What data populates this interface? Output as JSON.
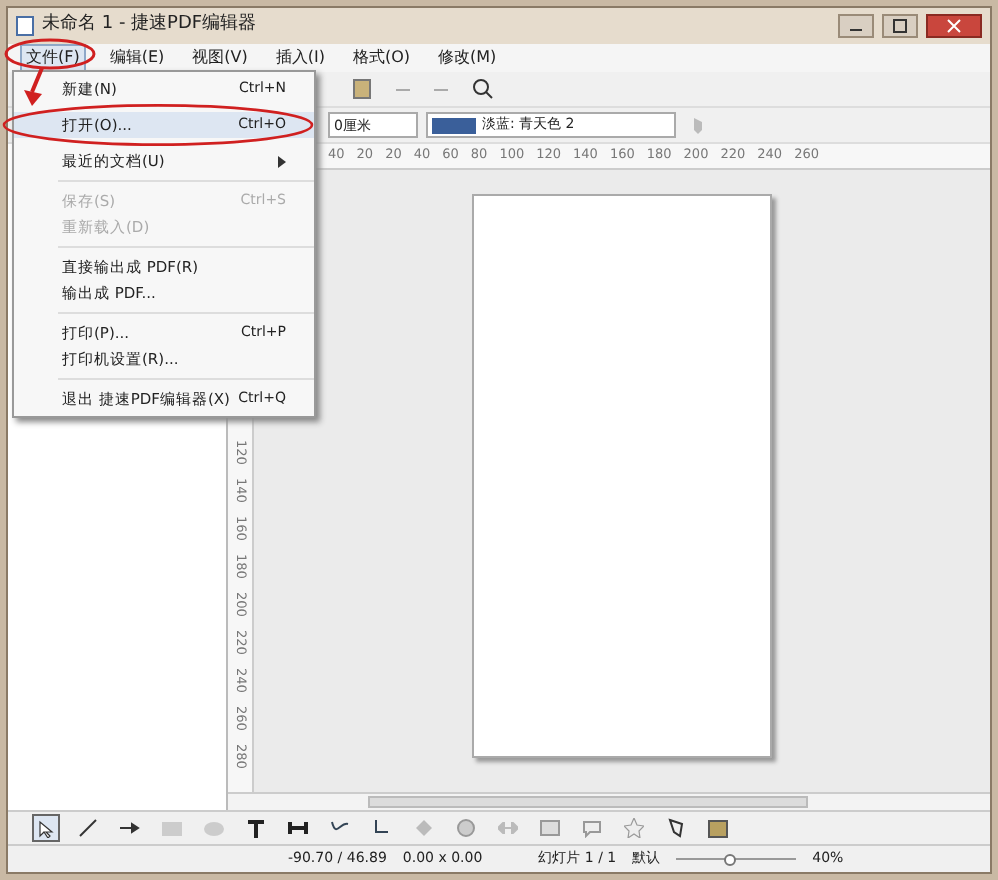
{
  "window": {
    "title": "未命名 1 - 捷速PDF编辑器"
  },
  "menu_bar": [
    {
      "label": "文件(F)",
      "selected": true
    },
    {
      "label": "编辑(E)",
      "selected": false
    },
    {
      "label": "视图(V)",
      "selected": false
    },
    {
      "label": "插入(I)",
      "selected": false
    },
    {
      "label": "格式(O)",
      "selected": false
    },
    {
      "label": "修改(M)",
      "selected": false
    }
  ],
  "file_menu": [
    {
      "kind": "item",
      "label": "新建(N)",
      "shortcut": "Ctrl+N",
      "disabled": false,
      "highlighted": false
    },
    {
      "kind": "item",
      "label": "打开(O)...",
      "shortcut": "Ctrl+O",
      "disabled": false,
      "highlighted": true
    },
    {
      "kind": "submenu",
      "label": "最近的文档(U)",
      "disabled": false,
      "highlighted": false
    },
    {
      "kind": "separator"
    },
    {
      "kind": "item",
      "label": "保存(S)",
      "shortcut": "Ctrl+S",
      "disabled": true,
      "highlighted": false
    },
    {
      "kind": "item",
      "label": "重新载入(D)",
      "disabled": true,
      "highlighted": false
    },
    {
      "kind": "separator"
    },
    {
      "kind": "item",
      "label": "直接输出成 PDF(R)",
      "disabled": false,
      "highlighted": false
    },
    {
      "kind": "item",
      "label": "输出成 PDF...",
      "disabled": false,
      "highlighted": false
    },
    {
      "kind": "separator"
    },
    {
      "kind": "item",
      "label": "打印(P)...",
      "shortcut": "Ctrl+P",
      "disabled": false,
      "highlighted": false
    },
    {
      "kind": "item",
      "label": "打印机设置(R)...",
      "disabled": false,
      "highlighted": false
    },
    {
      "kind": "separator"
    },
    {
      "kind": "item",
      "label": "退出 捷速PDF编辑器(X)",
      "shortcut": "Ctrl+Q",
      "disabled": false,
      "highlighted": false
    }
  ],
  "line_toolbar": {
    "line_width": "0厘米",
    "fill_color": "淡蓝: 青天色 2"
  },
  "horizontal_ruler": [
    "40",
    "20",
    "20",
    "40",
    "60",
    "80",
    "100",
    "120",
    "140",
    "160",
    "180",
    "200",
    "220",
    "240",
    "260"
  ],
  "vertical_ruler": [
    "120",
    "140",
    "160",
    "180",
    "200",
    "220",
    "240",
    "260",
    "280"
  ],
  "status_bar": {
    "position": "-90.70 / 46.89",
    "size": "0.00 x 0.00",
    "slide": "幻灯片 1 / 1",
    "layout": "默认",
    "zoom": "40%",
    "zoom_slider": {
      "level": 0.45
    }
  }
}
